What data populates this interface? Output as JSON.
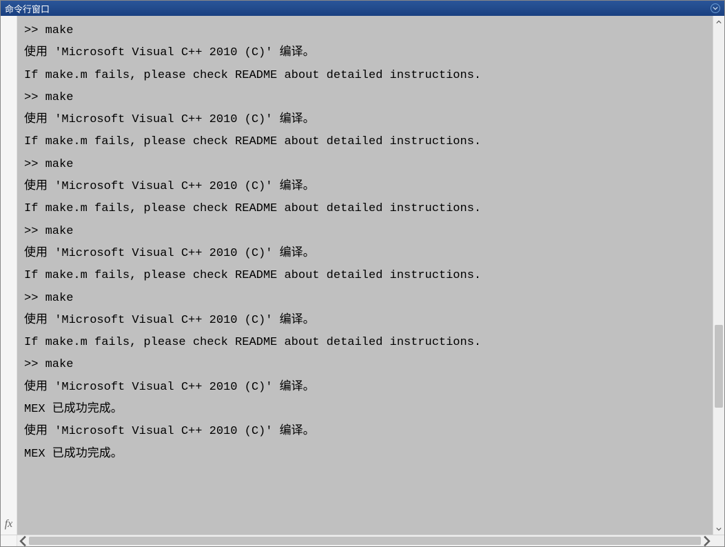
{
  "titlebar": {
    "title": "命令行窗口"
  },
  "gutter": {
    "fx_label": "fx"
  },
  "console": {
    "lines": [
      ">> make",
      "使用 'Microsoft Visual C++ 2010 (C)' 编译。",
      "If make.m fails, please check README about detailed instructions.",
      ">> make",
      "使用 'Microsoft Visual C++ 2010 (C)' 编译。",
      "If make.m fails, please check README about detailed instructions.",
      ">> make",
      "使用 'Microsoft Visual C++ 2010 (C)' 编译。",
      "If make.m fails, please check README about detailed instructions.",
      ">> make",
      "使用 'Microsoft Visual C++ 2010 (C)' 编译。",
      "If make.m fails, please check README about detailed instructions.",
      ">> make",
      "使用 'Microsoft Visual C++ 2010 (C)' 编译。",
      "If make.m fails, please check README about detailed instructions.",
      ">> make",
      "使用 'Microsoft Visual C++ 2010 (C)' 编译。",
      "MEX 已成功完成。",
      "使用 'Microsoft Visual C++ 2010 (C)' 编译。",
      "MEX 已成功完成。"
    ]
  }
}
